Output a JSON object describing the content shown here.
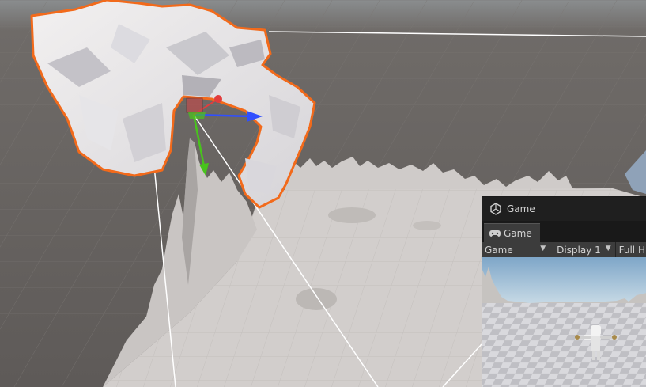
{
  "game_window": {
    "title": "Game",
    "tab_label": "Game",
    "toolbar": {
      "view_mode": "Game",
      "display": "Display 1",
      "aspect": "Full H"
    }
  },
  "icons": {
    "window": "unity-logo-icon",
    "tab": "gamepad-icon",
    "dropdown": "dropdown-arrow-icon"
  },
  "colors": {
    "selection_outline": "#f26a1b",
    "gizmo_x": "#e23d3d",
    "gizmo_y": "#48c41c",
    "gizmo_z": "#2f4fff",
    "sky": "#b5d0e0"
  }
}
